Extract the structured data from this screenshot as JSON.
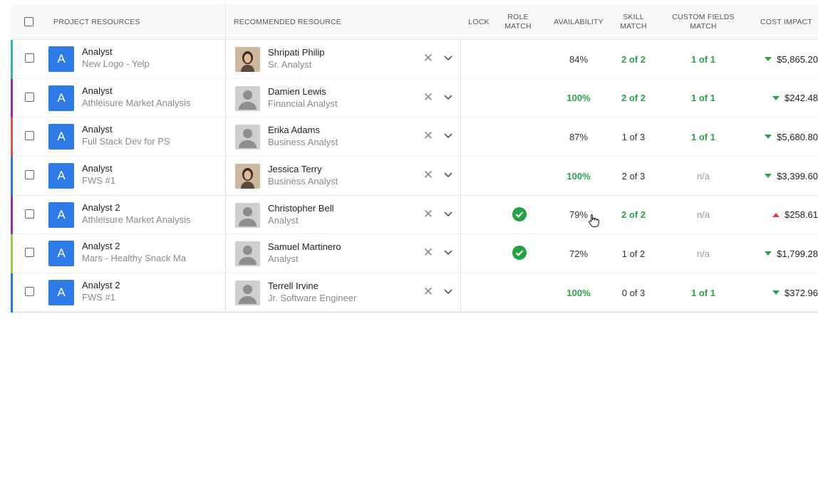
{
  "header": {
    "project_resources": "PROJECT RESOURCES",
    "recommended_resource": "RECOMMENDED RESOURCE",
    "lock": "LOCK",
    "role_match": "ROLE MATCH",
    "availability": "AVAILABILITY",
    "skill_match": "SKILL MATCH",
    "custom_fields_match": "CUSTOM FIELDS MATCH",
    "cost_impact": "COST IMPACT"
  },
  "colors": {
    "accent_blue": "#2e7be6",
    "match_green": "#29a348",
    "cost_up_red": "#e53935"
  },
  "rows": [
    {
      "stripe": "#2fb5b0",
      "badge": "A",
      "role": "Analyst",
      "project": "New Logo - Yelp",
      "person": "Shripati Philip",
      "person_title": "Sr. Analyst",
      "avatar": "photo",
      "remove_icon": "close-icon",
      "role_match": false,
      "availability": "84%",
      "availability_green": false,
      "skill_match": "2 of 2",
      "skill_green": true,
      "custom_fields": "1 of 1",
      "custom_green": true,
      "cost_direction": "down",
      "cost": "$5,865.20"
    },
    {
      "stripe": "#9c27b0",
      "badge": "A",
      "role": "Analyst",
      "project": "Athleisure Market Analysis",
      "person": "Damien Lewis",
      "person_title": "Financial Analyst",
      "avatar": "placeholder",
      "remove_icon": "close-icon",
      "role_match": false,
      "availability": "100%",
      "availability_green": true,
      "skill_match": "2 of 2",
      "skill_green": true,
      "custom_fields": "1 of 1",
      "custom_green": true,
      "cost_direction": "down",
      "cost": "$242.48"
    },
    {
      "stripe": "#e0524a",
      "badge": "A",
      "role": "Analyst",
      "project": "Full Stack Dev for PS",
      "person": "Erika Adams",
      "person_title": "Business Analyst",
      "avatar": "placeholder",
      "remove_icon": "close-icon",
      "role_match": false,
      "availability": "87%",
      "availability_green": false,
      "skill_match": "1 of 3",
      "skill_green": false,
      "custom_fields": "1 of 1",
      "custom_green": true,
      "cost_direction": "down",
      "cost": "$5,680.80"
    },
    {
      "stripe": "#1e7be0",
      "badge": "A",
      "role": "Analyst",
      "project": "FWS #1",
      "person": "Jessica Terry",
      "person_title": "Business Analyst",
      "avatar": "photo",
      "remove_icon": "close-icon",
      "role_match": false,
      "availability": "100%",
      "availability_green": true,
      "skill_match": "2 of 3",
      "skill_green": false,
      "custom_fields": "n/a",
      "custom_green": false,
      "cost_direction": "down",
      "cost": "$3,399.60"
    },
    {
      "stripe": "#9c27b0",
      "badge": "A",
      "role": "Analyst 2",
      "project": "Athleisure Market Analysis",
      "person": "Christopher Bell",
      "person_title": "Analyst",
      "avatar": "placeholder",
      "remove_icon": "close-icon",
      "role_match": true,
      "availability": "79%",
      "availability_green": false,
      "skill_match": "2 of 2",
      "skill_green": true,
      "custom_fields": "n/a",
      "custom_green": false,
      "cost_direction": "up",
      "cost": "$258.61"
    },
    {
      "stripe": "#9bd13a",
      "badge": "A",
      "role": "Analyst 2",
      "project": "Mars - Healthy Snack Ma",
      "person": "Samuel Martinero",
      "person_title": "Analyst",
      "avatar": "placeholder",
      "remove_icon": "close-icon",
      "role_match": true,
      "availability": "72%",
      "availability_green": false,
      "skill_match": "1 of 2",
      "skill_green": false,
      "custom_fields": "n/a",
      "custom_green": false,
      "cost_direction": "down",
      "cost": "$1,799.28"
    },
    {
      "stripe": "#1e7be0",
      "badge": "A",
      "role": "Analyst 2",
      "project": "FWS #1",
      "person": "Terrell Irvine",
      "person_title": "Jr. Software Engineer",
      "avatar": "placeholder",
      "remove_icon": "close-icon",
      "role_match": false,
      "availability": "100%",
      "availability_green": true,
      "skill_match": "0 of 3",
      "skill_green": false,
      "custom_fields": "1 of 1",
      "custom_green": true,
      "cost_direction": "down",
      "cost": "$372.96"
    }
  ]
}
